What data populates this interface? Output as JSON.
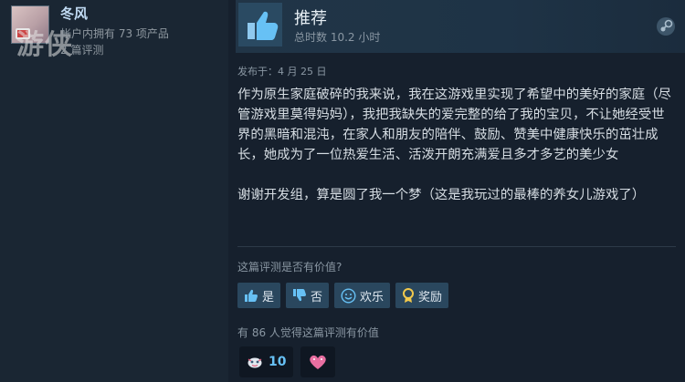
{
  "author": {
    "name": "冬风",
    "products_text": "帐户内拥有 73 项产品",
    "reviews_text": "2 篇评测",
    "watermark": "游侠"
  },
  "review": {
    "verdict": "推荐",
    "hours": "总时数 10.2 小时",
    "posted": "发布于：4 月 25 日",
    "paragraph1": "作为原生家庭破碎的我来说，我在这游戏里实现了希望中的美好的家庭（尽管游戏里莫得妈妈），我把我缺失的爱完整的给了我的宝贝，不让她经受世界的黑暗和混沌，在家人和朋友的陪伴、鼓励、赞美中健康快乐的茁壮成长，她成为了一位热爱生活、活泼开朗充满爱且多才多艺的美少女",
    "paragraph2": "谢谢开发组，算是圆了我一个梦（这是我玩过的最棒的养女儿游戏了）"
  },
  "helpful": {
    "question": "这篇评测是否有价值?",
    "yes": "是",
    "no": "否",
    "funny": "欢乐",
    "award": "奖励",
    "count_text": "有 86 人觉得这篇评测有价值"
  },
  "awards": [
    {
      "icon": "award-face-icon",
      "count": "10"
    },
    {
      "icon": "heart-icon",
      "count": ""
    }
  ],
  "colors": {
    "background": "#1b2838",
    "accent": "#67c1f5",
    "button": "#2a475e"
  }
}
